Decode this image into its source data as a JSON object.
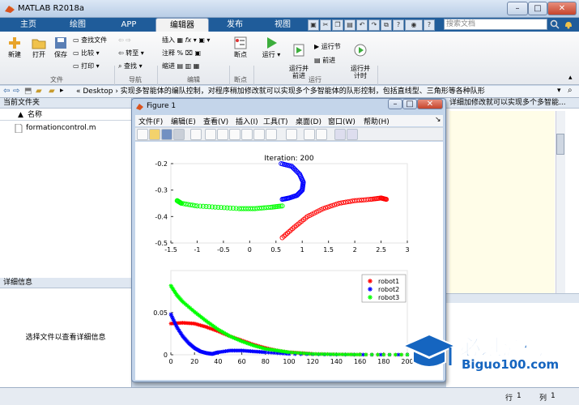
{
  "app": {
    "title": "MATLAB R2018a",
    "min": "–",
    "max": "□",
    "close": "✕"
  },
  "tabs": [
    "主页",
    "绘图",
    "APP",
    "编辑器",
    "发布",
    "视图"
  ],
  "search": {
    "placeholder": "搜索文档"
  },
  "ribbon": {
    "file": {
      "group": "文件",
      "new": "新建",
      "open": "打开",
      "save": "保存",
      "find_files": "查找文件",
      "compare": "比较",
      "print": "打印"
    },
    "nav": {
      "group": "导航",
      "goto": "转至",
      "find": "查找"
    },
    "edit": {
      "group": "编辑",
      "insert": "插入",
      "comment": "注释",
      "indent": "缩进",
      "fx": "fx"
    },
    "bp": {
      "group": "断点",
      "breakpoints": "断点"
    },
    "run": {
      "group": "运行",
      "run": "运行",
      "run_advance": "运行并\n前进",
      "run_section": "运行节",
      "advance": "前进",
      "run_time": "运行并\n计时"
    }
  },
  "address": {
    "path": "« Desktop › 实现多智能体的编队控制，对程序稍加修改就可以实现多个多智能体的队形控制，包括直线型、三角形等各种队形"
  },
  "current_folder": {
    "header": "当前文件夹",
    "col_name": "名称",
    "sort": "▲",
    "file": "formationcontrol.m"
  },
  "details": {
    "header": "详细信息",
    "msg": "选择文件以查看详细信息"
  },
  "right": {
    "header": "详细加修改就可以实现多个多智能..."
  },
  "status": {
    "row_label": "行",
    "row": "1",
    "col_label": "列",
    "col": "1"
  },
  "figure": {
    "title": "Figure 1",
    "menu": [
      "文件(F)",
      "编辑(E)",
      "查看(V)",
      "插入(I)",
      "工具(T)",
      "桌面(D)",
      "窗口(W)",
      "帮助(H)"
    ]
  },
  "colors": {
    "red": "#ff0000",
    "blue": "#0000ff",
    "green": "#00ff00"
  },
  "chart_data": [
    {
      "type": "scatter",
      "title": "Iteration: 200",
      "xlim": [
        -1.5,
        3
      ],
      "ylim": [
        -0.5,
        -0.2
      ],
      "xticks": [
        "-1.5",
        "-1",
        "-0.5",
        "0",
        "0.5",
        "1",
        "1.5",
        "2",
        "2.5",
        "3"
      ],
      "yticks": [
        "-0.2",
        "-0.3",
        "-0.4",
        "-0.5"
      ],
      "series": [
        {
          "color": "red",
          "marker": "o",
          "x": [
            0.62,
            0.85,
            1.1,
            1.4,
            1.7,
            2.0,
            2.3,
            2.5,
            2.6
          ],
          "y": [
            -0.48,
            -0.44,
            -0.4,
            -0.37,
            -0.35,
            -0.34,
            -0.335,
            -0.33,
            -0.335
          ]
        },
        {
          "color": "blue",
          "marker": "o",
          "x": [
            0.6,
            0.8,
            0.95,
            1.02,
            1.0,
            0.9,
            0.75,
            0.62
          ],
          "y": [
            -0.2,
            -0.21,
            -0.24,
            -0.27,
            -0.3,
            -0.32,
            -0.33,
            -0.335
          ]
        },
        {
          "color": "green",
          "marker": "o",
          "x": [
            -1.38,
            -1.3,
            -1.0,
            -0.6,
            -0.2,
            0.1,
            0.4,
            0.62
          ],
          "y": [
            -0.34,
            -0.35,
            -0.36,
            -0.365,
            -0.37,
            -0.37,
            -0.365,
            -0.36
          ]
        }
      ]
    },
    {
      "type": "line",
      "xlim": [
        0,
        200
      ],
      "ylim": [
        0,
        0.1
      ],
      "xticks": [
        "0",
        "20",
        "40",
        "60",
        "80",
        "100",
        "120",
        "140",
        "160",
        "180",
        "200"
      ],
      "yticks": [
        "0",
        "0.05"
      ],
      "legend": "top-right",
      "series": [
        {
          "name": "robot1",
          "color": "red",
          "x": [
            0,
            10,
            20,
            30,
            40,
            50,
            60,
            70,
            80,
            90,
            100,
            110,
            120,
            140,
            160,
            200
          ],
          "y": [
            0.037,
            0.038,
            0.037,
            0.033,
            0.028,
            0.022,
            0.017,
            0.012,
            0.008,
            0.005,
            0.003,
            0.002,
            0.001,
            0.0005,
            0.0002,
            0.0001
          ]
        },
        {
          "name": "robot2",
          "color": "blue",
          "x": [
            0,
            5,
            10,
            15,
            20,
            25,
            30,
            35,
            40,
            50,
            60,
            70,
            80,
            100,
            140,
            200
          ],
          "y": [
            0.048,
            0.033,
            0.022,
            0.014,
            0.008,
            0.004,
            0.002,
            0.001,
            0.003,
            0.005,
            0.005,
            0.004,
            0.003,
            0.001,
            0.0002,
            0.0001
          ]
        },
        {
          "name": "robot3",
          "color": "green",
          "x": [
            0,
            5,
            10,
            20,
            30,
            40,
            50,
            60,
            70,
            80,
            90,
            100,
            120,
            140,
            160,
            200
          ],
          "y": [
            0.082,
            0.071,
            0.063,
            0.051,
            0.04,
            0.03,
            0.022,
            0.016,
            0.011,
            0.007,
            0.005,
            0.003,
            0.001,
            0.0005,
            0.0002,
            0.0001
          ]
        }
      ]
    }
  ],
  "watermark": {
    "line1": "必过源码",
    "line2": "Biguo100.com"
  }
}
